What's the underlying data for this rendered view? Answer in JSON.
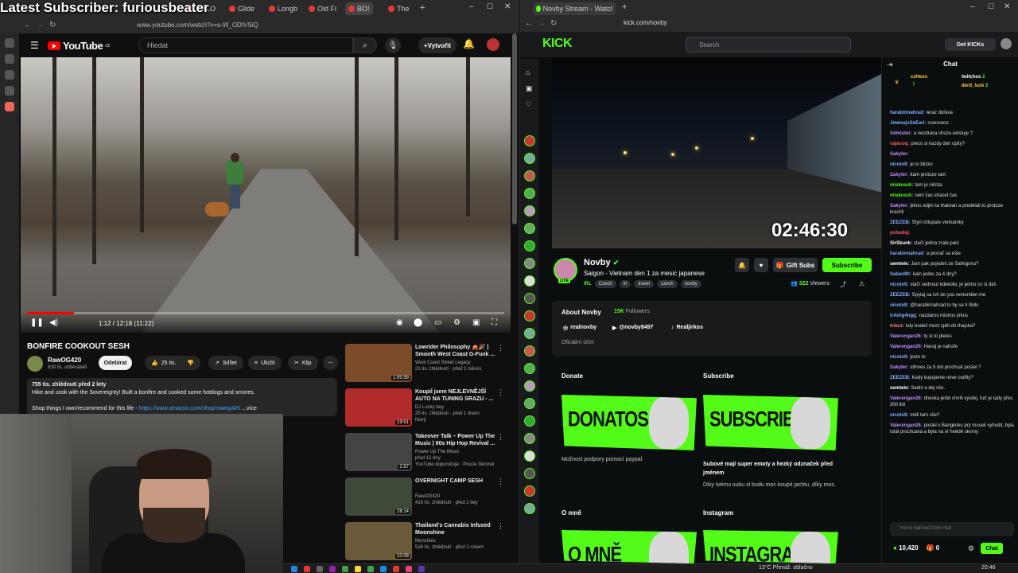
{
  "overlay": {
    "text": "Latest Subscriber: furiousbeater"
  },
  "left_browser": {
    "tabs": [
      "KALO",
      "Glide",
      "Longb",
      "Old Fi",
      "BO!",
      "The"
    ],
    "url": "www.youtube.com/watch?v=s-W_ODIVSiQ"
  },
  "youtube": {
    "logo": "YouTube",
    "logo_region": "CZ",
    "search_placeholder": "Hledat",
    "create_label": "Vytvořit",
    "player": {
      "time": "1:12 / 12:18 (11:22)",
      "progress": 0.098
    },
    "video_title": "BONFIRE COOKOUT SESH",
    "channel": {
      "name": "RawOG420",
      "subs": "839 tis. odběratelů",
      "subscribe_label": "Odebírat"
    },
    "actions": {
      "likes": "25 tis.",
      "share": "Sdílet",
      "save": "Uložit",
      "clip": "Klip"
    },
    "description": {
      "line1": "755 tis. zhlédnutí  před 2 lety",
      "line2": "Hike and cook with the Sovereignty! Built a bonfire and cooked some hotdogs and smores.",
      "line3": "Shop things I own/recommend for this life - ",
      "link": "https://www.amazon.com/shop/rawog420",
      "more": " ...více"
    },
    "related": [
      {
        "title": "Lowrider Philosophy 🎪🎉 | Smooth West Coast G-Funk ...",
        "channel": "West Coast Street Legacy",
        "meta": "21 tis. zhlédnutí · před 2 měsíci",
        "extra": "",
        "duration": "1:05:58",
        "thumb_color": "#7b4b2a"
      },
      {
        "title": "Koupil jsem NEJLEVNĚJŠÍ AUTO NA TUNING SRAZU - ...",
        "channel": "DJ Lucky boy",
        "meta": "25 tis. zhlédnutí · před 1 dnem",
        "extra": "Nový",
        "duration": "19:51",
        "thumb_color": "#b22b2b"
      },
      {
        "title": "Takeover Talk – Power Up The Music | 90s Hip Hop Revival ...",
        "channel": "Power Up The Music",
        "meta": "před 12 dny",
        "extra": "YouTube doporučuje · Pouze členové",
        "duration": "2:57",
        "thumb_color": "#444444"
      },
      {
        "title": "OVERNIGHT CAMP SESH",
        "channel": "RawOG420",
        "meta": "416 tis. zhlédnutí · před 2 lety",
        "extra": "",
        "duration": "28:14",
        "thumb_color": "#3d4a3a"
      },
      {
        "title": "Thailand's Cannabis Infused Moonshine",
        "channel": "Munchies",
        "meta": "516 tis. zhlédnutí · před 1 rokem",
        "extra": "",
        "duration": "10:08",
        "thumb_color": "#6a5a3a"
      }
    ]
  },
  "right_browser": {
    "tab": "Novby Stream - Watch Live o...",
    "url": "kick.com/novby"
  },
  "kick": {
    "logo": "KICK",
    "search_placeholder": "Search",
    "get_kicks": "Get KICKs",
    "timer": "02:46:30",
    "streamer": "Novby",
    "live_badge": "LIVE",
    "stream_title": "Saigon - Vietnam den 1 za mesic japanese",
    "lang": "IRL",
    "tags": [
      "Czech",
      "irl",
      "travel",
      "czech",
      "novby"
    ],
    "gift_subs": "Gift Subs",
    "subscribe": "Subscribe",
    "viewers": "322",
    "viewers_label": "Viewers",
    "about": {
      "title": "About Novby",
      "followers": "15K",
      "followers_label": "Followers",
      "insta": "realnovby",
      "youtube": "@novby8497",
      "tiktok": "Realjirkos",
      "official": "Oficiální účet"
    },
    "panels": {
      "donate_title": "Donate",
      "donate_banner": "DONATOSS",
      "donate_desc": "Možnost podpory pomocí paypal",
      "subscribe_title": "Subscribe",
      "subscribe_banner": "SUBSCRIBE",
      "subscribe_desc1": "Subové mají super emoty a hezký odznaček před jménem",
      "subscribe_desc2": "Díky tvému subu si budu moc koupit jachtu, díky moc.",
      "about_title": "O mně",
      "about_banner": "O MNĚ",
      "insta_title": "Instagram",
      "insta_banner": "INSTAGRAM"
    },
    "chat": {
      "title": "Chat",
      "pins": [
        {
          "name": "czHeso",
          "count": "7"
        },
        {
          "name": "twitchos",
          "count": "2"
        },
        {
          "name": "derd_luck",
          "count": "2"
        }
      ],
      "messages": [
        {
          "user": "harabinnahrad:",
          "text": "teraz doľava",
          "color": "#7fb0ff"
        },
        {
          "user": "JmenujuSeEarl:",
          "text": "cooooooo",
          "color": "#7fb0ff"
        },
        {
          "user": "Xdmister:",
          "text": "a nezdrava chuze existuje ?",
          "color": "#c08aff"
        },
        {
          "user": "vajecoq:",
          "text": "preco si kazdy den opity?",
          "color": "#ff5a5a"
        },
        {
          "user": "Sakyler:",
          "text": "",
          "color": "#c08aff"
        },
        {
          "user": "nicoto9:",
          "text": "je to blizko",
          "color": "#7fb0ff"
        },
        {
          "user": "Sakyler:",
          "text": "ttam   protoze tam",
          "color": "#c08aff"
        },
        {
          "user": "miskosvk:",
          "text": "tam je ničota",
          "color": "#53fc18"
        },
        {
          "user": "miskosvk:",
          "text": "neni čas stracet čas",
          "color": "#53fc18"
        },
        {
          "user": "Sakyler:",
          "text": "jirkos odjel na thaiwan a predelali to protoze krachli",
          "color": "#c08aff"
        },
        {
          "user": "ZEEZEB:",
          "text": "Styri chlupate vietnamky",
          "color": "#7fb0ff"
        },
        {
          "user": "pobudaj:",
          "text": "",
          "color": "#ff5a5a"
        },
        {
          "user": "SirSkunk:",
          "text": "stačí jedna zrala pani",
          "color": "#ffffff"
        },
        {
          "user": "harabinnahrad:",
          "text": "a posrať sa ešte",
          "color": "#7fb0ff"
        },
        {
          "user": "semtele:",
          "text": "Jam pak pojedeš ze Saihigonu?",
          "color": "#ffffff"
        },
        {
          "user": "Saban90:",
          "text": "kam jedes za 4 dny?",
          "color": "#7fb0ff"
        },
        {
          "user": "nicoto9:",
          "text": "stačí sednout kdekoliv, je jedno co si dáš",
          "color": "#7fb0ff"
        },
        {
          "user": "ZEEZEB:",
          "text": "Spytaj sa ich do you remember me",
          "color": "#7fb0ff"
        },
        {
          "user": "nicoto9:",
          "text": "@harabinnahrad to by se ti líbilo",
          "color": "#7fb0ff"
        },
        {
          "user": "tr4shg4ngg:",
          "text": "nazdaros mistros jirkos",
          "color": "#7fb0ff"
        },
        {
          "user": "triocz:",
          "text": "kdy budeš moct zpět do thajska?",
          "color": "#ff8c8c"
        },
        {
          "user": "Valerengan26:",
          "text": "ty si to pletes",
          "color": "#c08aff"
        },
        {
          "user": "Valerengan26:",
          "text": "Hanoj je nahoře",
          "color": "#c08aff"
        },
        {
          "user": "nicoto9:",
          "text": "jeste to ",
          "color": "#7fb0ff"
        },
        {
          "user": "Sakyler:",
          "text": "stihnes za 5 dni prochcat postel ?",
          "color": "#c08aff"
        },
        {
          "user": "ZEEZEB:",
          "text": "Kedy kupujeme nove outfity?",
          "color": "#7fb0ff"
        },
        {
          "user": "semtele:",
          "text": "Sedni a dej vše.",
          "color": "#ffffff"
        },
        {
          "user": "Valerengan26:",
          "text": "dneska ještě chvíli vysilej, furt je tady přes 300 lidí",
          "color": "#c08aff"
        },
        {
          "user": "nicoto9:",
          "text": "měli tam vše?",
          "color": "#7fb0ff"
        },
        {
          "user": "Valerengan26:",
          "text": "postel v Bangkoku prý museli vyhodit, byla totál prochcaná a byla na ní hnědé skvrny",
          "color": "#c08aff"
        }
      ],
      "input_placeholder": "You're banned from chat",
      "points": "10,420",
      "zero": "0",
      "send": "Chat"
    }
  },
  "taskbar": {
    "weather": "13°C  Převáž. oblačno",
    "time": "20:46"
  }
}
